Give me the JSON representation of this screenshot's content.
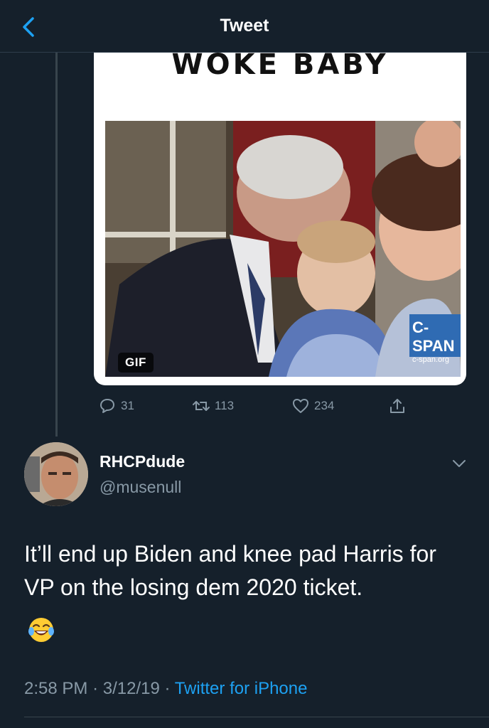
{
  "header": {
    "title": "Tweet"
  },
  "quoted_media": {
    "caption": "WOKE BABY",
    "gif_label": "GIF",
    "cspan_logo": "C-SPAN",
    "cspan_url": "c-span.org"
  },
  "actions": {
    "reply_count": "31",
    "retweet_count": "113",
    "like_count": "234"
  },
  "reply": {
    "user_name": "RHCPdude",
    "handle": "@musenull",
    "text": "It’ll end up Biden and knee pad Harris for VP on the losing dem 2020 ticket.",
    "emoji": "face-with-tears-of-joy",
    "time": "2:58 PM",
    "date": "3/12/19",
    "source": "Twitter for iPhone"
  },
  "colors": {
    "background": "#15202b",
    "accent": "#1da1f2",
    "muted": "#8899a6",
    "divider": "#38444d"
  }
}
